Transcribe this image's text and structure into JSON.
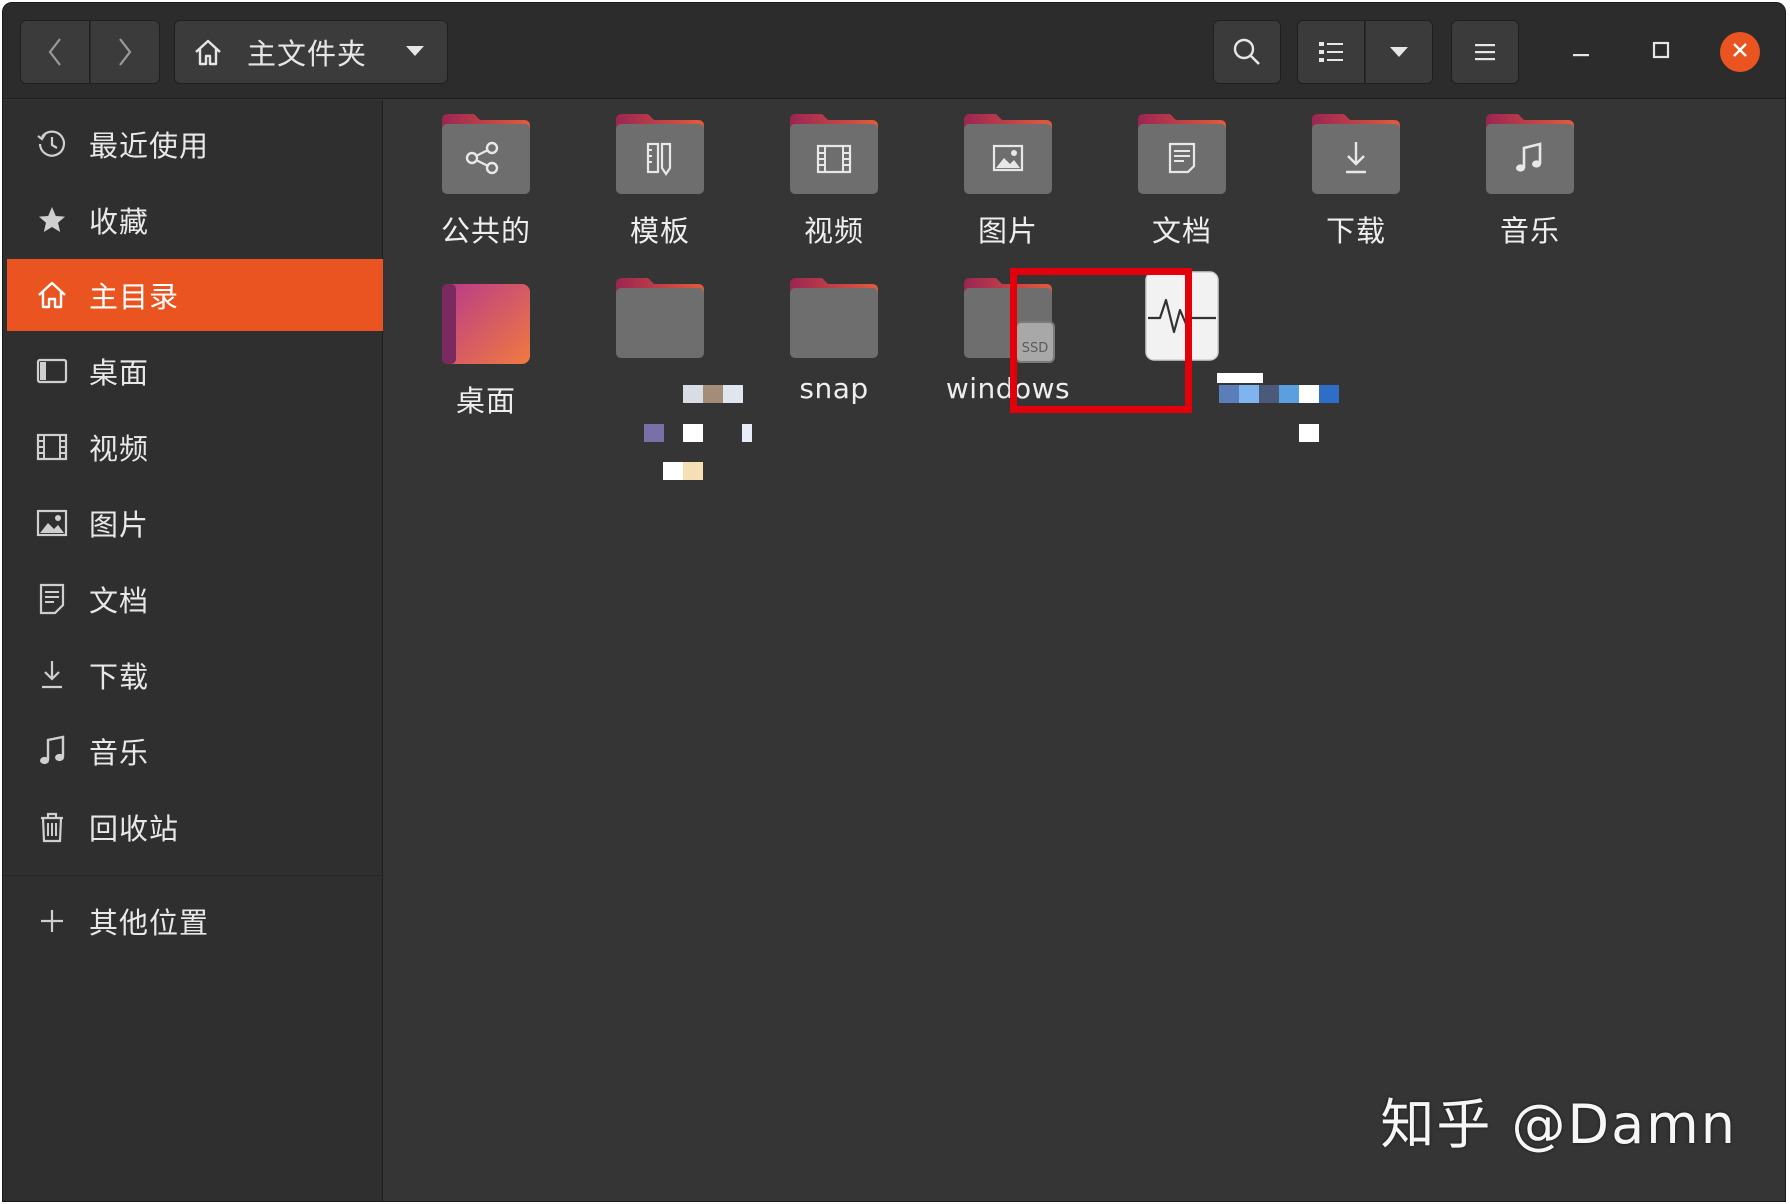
{
  "header": {
    "back_icon": "chevron-left-icon",
    "forward_icon": "chevron-right-icon",
    "path_icon": "home-icon",
    "path_label": "主文件夹",
    "search_icon": "search-icon",
    "view_icon": "list-view-icon",
    "menu_icon": "hamburger-menu-icon"
  },
  "sidebar": {
    "items": [
      {
        "label": "最近使用",
        "icon": "clock-icon"
      },
      {
        "label": "收藏",
        "icon": "star-icon"
      },
      {
        "label": "主目录",
        "icon": "home-icon",
        "active": true
      },
      {
        "label": "桌面",
        "icon": "desktop-icon"
      },
      {
        "label": "视频",
        "icon": "film-icon"
      },
      {
        "label": "图片",
        "icon": "picture-icon"
      },
      {
        "label": "文档",
        "icon": "document-icon"
      },
      {
        "label": "下载",
        "icon": "download-icon"
      },
      {
        "label": "音乐",
        "icon": "music-note-icon"
      },
      {
        "label": "回收站",
        "icon": "trash-icon"
      },
      {
        "label": "其他位置",
        "icon": "plus-icon"
      }
    ]
  },
  "files": [
    {
      "name": "公共的",
      "icon": "share-folder-icon"
    },
    {
      "name": "模板",
      "icon": "template-folder-icon"
    },
    {
      "name": "视频",
      "icon": "video-folder-icon"
    },
    {
      "name": "图片",
      "icon": "picture-folder-icon"
    },
    {
      "name": "文档",
      "icon": "document-folder-icon"
    },
    {
      "name": "下载",
      "icon": "download-folder-icon"
    },
    {
      "name": "音乐",
      "icon": "music-folder-icon"
    },
    {
      "name": "桌面",
      "icon": "desktop-folder-icon"
    },
    {
      "name": "",
      "icon": "folder-icon"
    },
    {
      "name": "snap",
      "icon": "folder-icon"
    },
    {
      "name": "windows",
      "icon": "ssd-drive-folder-icon"
    },
    {
      "name": "",
      "icon": "system-monitor-file-icon"
    }
  ],
  "colors": {
    "accent": "#e95420",
    "highlight": "#e3000b",
    "window_bg": "#353535",
    "sidebar_bg": "#2f2f2f"
  },
  "watermark": "知乎 @Damn"
}
